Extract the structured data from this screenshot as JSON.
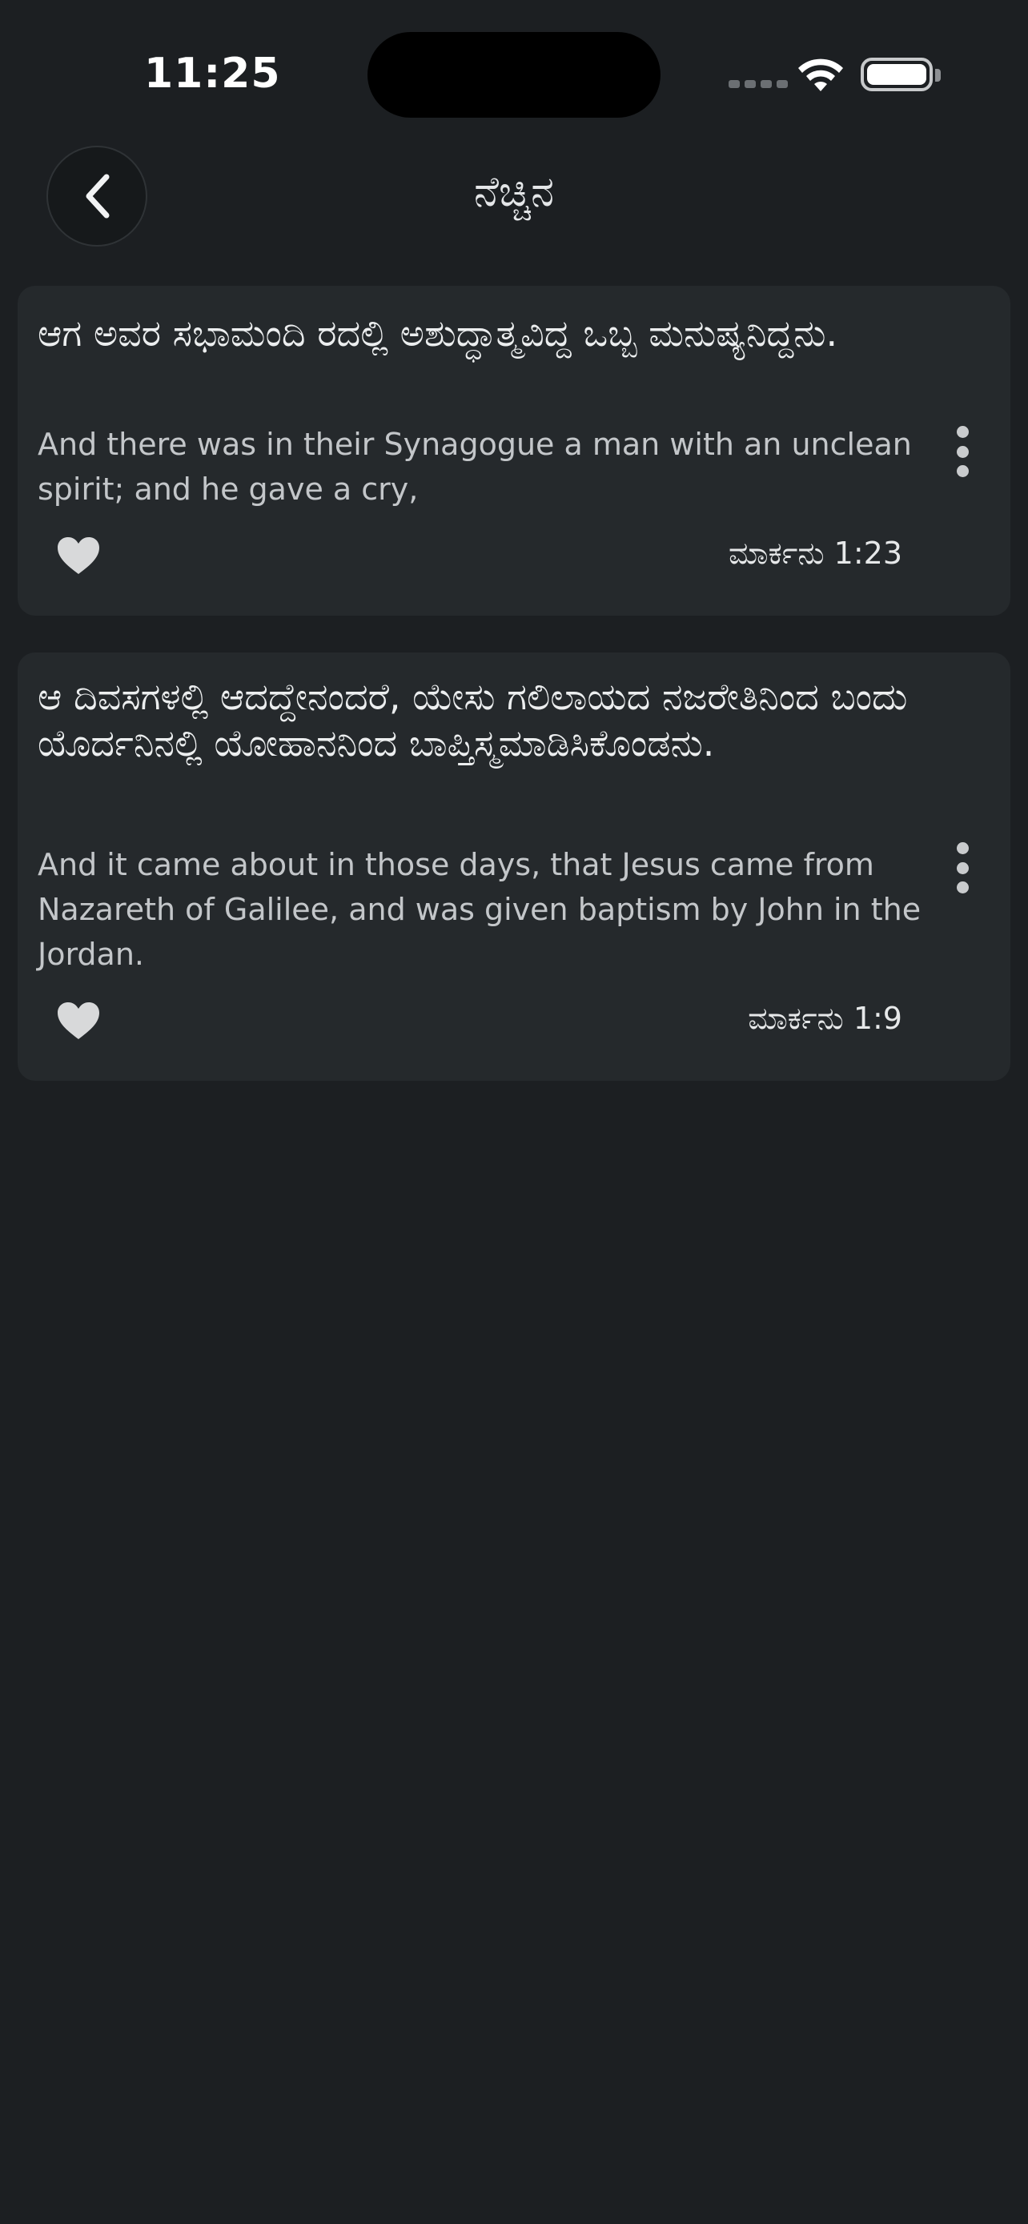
{
  "status_bar": {
    "time": "11:25"
  },
  "header": {
    "title": "ನೆಚ್ಚಿನ"
  },
  "favorites": [
    {
      "kannada": "ಆಗ ಅವರ ಸಭಾಮಂದಿ ರದಲ್ಲಿ ಅಶುದ್ಧಾತ್ಮವಿದ್ದ ಒಬ್ಬ ಮನುಷ್ಯನಿದ್ದನು.",
      "english": "And there was in their Synagogue a man with an unclean spirit; and he gave a cry,",
      "reference": "ಮಾರ್ಕನು 1:23"
    },
    {
      "kannada": "ಆ ದಿವಸಗಳಲ್ಲಿ ಆದದ್ದೇನಂದರೆ, ಯೇಸು ಗಲಿಲಾಯದ ನಜರೇತಿನಿಂದ ಬಂದು ಯೊರ್ದನಿನಲ್ಲಿ ಯೋಹಾನನಿಂದ ಬಾಪ್ತಿಸ್ಮಮಾಡಿಸಿಕೊಂಡನು.",
      "english": "And it came about in those days, that Jesus came from Nazareth of Galilee, and was given baptism by John in the Jordan.",
      "reference": "ಮಾರ್ಕನು 1:9"
    }
  ],
  "icons": {
    "back": "chevron-left-icon",
    "favorite": "heart-icon",
    "more": "more-vertical-icon"
  },
  "colors": {
    "background": "#1c1f22",
    "card": "#25292c",
    "text_primary": "#eceeef",
    "text_secondary": "#c3c6c9",
    "icon": "#d8d9da"
  }
}
